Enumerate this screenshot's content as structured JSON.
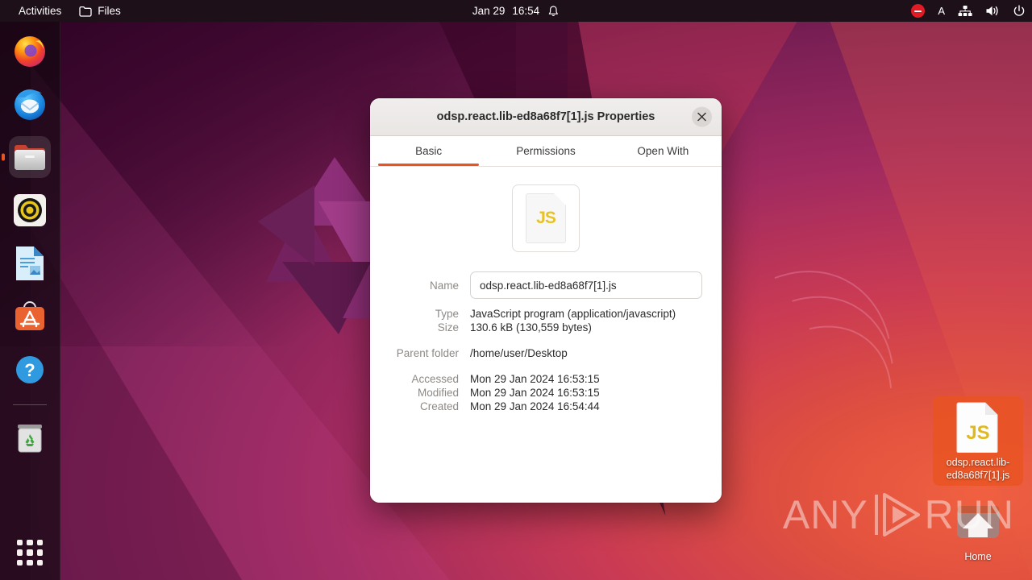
{
  "topbar": {
    "activities_label": "Activities",
    "app_menu_label": "Files",
    "app_menu_icon": "folder-icon",
    "clock_date": "Jan 29",
    "clock_time": "16:54",
    "notification_icon": "bell-icon",
    "dnd_icon": "do-not-disturb-icon",
    "keyboard_layout": "A",
    "network_icon": "network-wired-icon",
    "volume_icon": "volume-icon",
    "power_icon": "power-icon",
    "background": "#1d1019"
  },
  "dock": {
    "items": [
      {
        "name": "firefox",
        "label": "Firefox",
        "icon": "firefox-icon",
        "running": false
      },
      {
        "name": "thunderbird",
        "label": "Thunderbird",
        "icon": "thunderbird-icon",
        "running": false
      },
      {
        "name": "files",
        "label": "Files",
        "icon": "files-icon",
        "running": true
      },
      {
        "name": "rhythmbox",
        "label": "Rhythmbox",
        "icon": "rhythmbox-icon",
        "running": false
      },
      {
        "name": "libreoffice-writer",
        "label": "LibreOffice Writer",
        "icon": "libreoffice-writer-icon",
        "running": false
      },
      {
        "name": "ubuntu-software",
        "label": "Ubuntu Software",
        "icon": "ubuntu-software-icon",
        "running": false
      },
      {
        "name": "help",
        "label": "Help",
        "icon": "help-icon",
        "running": false
      },
      {
        "name": "trash",
        "label": "Trash",
        "icon": "trash-icon",
        "running": false
      }
    ],
    "show_apps_label": "Show Applications",
    "show_apps_icon": "apps-grid-icon",
    "running_indicator_color": "#e95420"
  },
  "desktop": {
    "icons": [
      {
        "name": "odsp-js-file",
        "label": "odsp.react.lib-ed8a68f7[1].js",
        "icon": "javascript-file-icon",
        "selected": true,
        "selection_color": "#e95420"
      },
      {
        "name": "home-folder",
        "label": "Home",
        "icon": "home-folder-icon",
        "selected": false
      }
    ]
  },
  "watermark": {
    "text_left": "ANY",
    "text_right": "RUN",
    "icon": "play-triangle-icon"
  },
  "dialog": {
    "title": "odsp.react.lib-ed8a68f7[1].js Properties",
    "close_icon": "close-icon",
    "close_label": "Close",
    "accent_color": "#e95420",
    "tabs": [
      {
        "label": "Basic",
        "active": true
      },
      {
        "label": "Permissions",
        "active": false
      },
      {
        "label": "Open With",
        "active": false
      }
    ],
    "file_icon": {
      "type": "javascript-file-icon",
      "badge_text": "JS",
      "badge_color": "#e8c225"
    },
    "fields": {
      "name_label": "Name",
      "name_value": "odsp.react.lib-ed8a68f7[1].js",
      "type_label": "Type",
      "type_value": "JavaScript program (application/javascript)",
      "size_label": "Size",
      "size_value": "130.6 kB (130,559 bytes)",
      "parent_folder_label": "Parent folder",
      "parent_folder_value": "/home/user/Desktop",
      "accessed_label": "Accessed",
      "accessed_value": "Mon 29 Jan 2024 16:53:15",
      "modified_label": "Modified",
      "modified_value": "Mon 29 Jan 2024 16:53:15",
      "created_label": "Created",
      "created_value": "Mon 29 Jan 2024 16:54:44"
    }
  }
}
